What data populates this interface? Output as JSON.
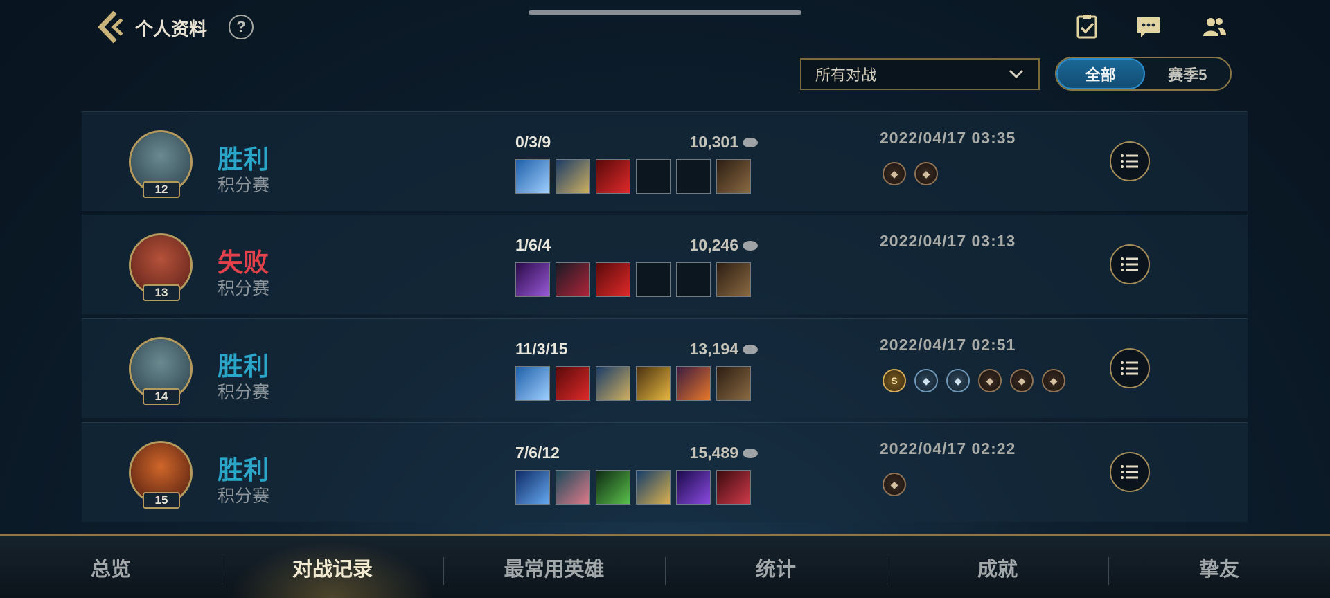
{
  "header": {
    "title": "个人资料",
    "help_label": "?",
    "icons": [
      "checklist-icon",
      "chat-icon",
      "friends-icon"
    ]
  },
  "filters": {
    "dropdown_value": "所有对战",
    "segment_options": [
      "全部",
      "赛季5"
    ],
    "segment_active": "全部"
  },
  "matches": [
    {
      "champion_level": "12",
      "result": "胜利",
      "result_type": "win",
      "mode": "积分赛",
      "kda": "0/3/9",
      "gold": "10,301",
      "items": [
        "blue-blade-item",
        "lance-item",
        "red-claw-item",
        "empty-slot",
        "empty-slot",
        "boots-item"
      ],
      "datetime": "2022/04/17 03:35",
      "badges": [
        "mvp-badge",
        "assist-badge"
      ]
    },
    {
      "champion_level": "13",
      "result": "失败",
      "result_type": "loss",
      "mode": "积分赛",
      "kda": "1/6/4",
      "gold": "10,246",
      "items": [
        "purple-sword-item",
        "dark-blade-item",
        "red-claw-item",
        "empty-slot",
        "empty-slot",
        "boots-item"
      ],
      "datetime": "2022/04/17 03:13",
      "badges": []
    },
    {
      "champion_level": "14",
      "result": "胜利",
      "result_type": "win",
      "mode": "积分赛",
      "kda": "11/3/15",
      "gold": "13,194",
      "items": [
        "blue-blade-item",
        "red-claw-item",
        "lance-item",
        "gold-hammer-item",
        "flame-bow-item",
        "boots-item"
      ],
      "datetime": "2022/04/17 02:51",
      "badges": [
        "s-badge",
        "wing-badge",
        "crown-badge",
        "shield-badge",
        "boot-badge",
        "helm-badge"
      ],
      "badge_text": "S"
    },
    {
      "champion_level": "15",
      "result": "胜利",
      "result_type": "win",
      "mode": "积分赛",
      "kda": "7/6/12",
      "gold": "15,489",
      "items": [
        "crystal-item",
        "mask-item",
        "green-claw-item",
        "blue-sword-item",
        "purple-staff-item",
        "red-boots-item"
      ],
      "datetime": "2022/04/17 02:22",
      "badges": [
        "shield-badge"
      ]
    }
  ],
  "bottom_nav": {
    "tabs": [
      "总览",
      "对战记录",
      "最常用英雄",
      "统计",
      "成就",
      "挚友"
    ],
    "active": "对战记录"
  },
  "colors": {
    "win": "#2ba5c8",
    "loss": "#e0414a",
    "gold_accent": "#b59a5e",
    "segment_active": "#1a6796"
  }
}
